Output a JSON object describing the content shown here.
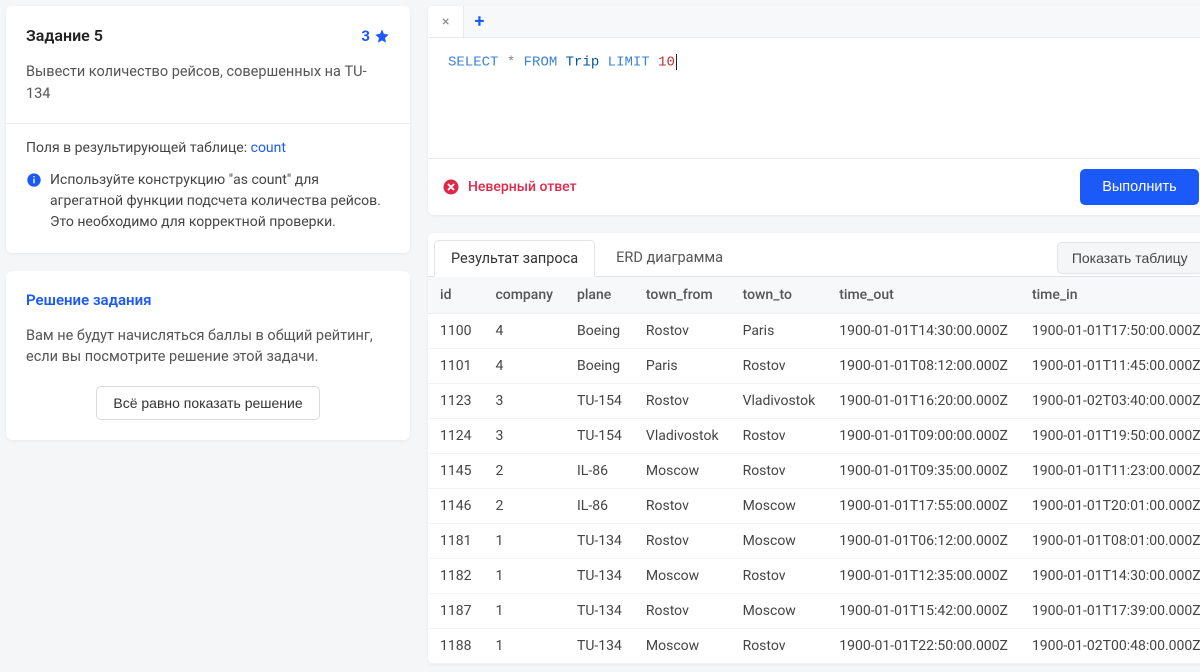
{
  "task": {
    "title": "Задание 5",
    "rating": "3",
    "description": "Вывести количество рейсов, совершенных на TU-134",
    "fields_label": "Поля в результирующей таблице:",
    "fields_value": "count",
    "hint": "Используйте конструкцию \"as count\" для агрегатной функции подсчета количества рейсов. Это необходимо для корректной проверки."
  },
  "solution": {
    "title": "Решение задания",
    "warning": "Вам не будут начисляться баллы в общий рейтинг, если вы посмотрите решение этой задачи.",
    "show_button": "Всё равно показать решение"
  },
  "editor": {
    "tab_label": "",
    "query_tokens": {
      "select": "SELECT",
      "star": "*",
      "from": "FROM",
      "table": "Trip",
      "limit": "LIMIT",
      "num": "10"
    }
  },
  "exec": {
    "error": "Неверный ответ",
    "button": "Выполнить"
  },
  "result": {
    "tab_result": "Результат запроса",
    "tab_erd": "ERD диаграмма",
    "show_table": "Показать таблицу",
    "columns": [
      "id",
      "company",
      "plane",
      "town_from",
      "town_to",
      "time_out",
      "time_in"
    ],
    "rows": [
      [
        "1100",
        "4",
        "Boeing",
        "Rostov",
        "Paris",
        "1900-01-01T14:30:00.000Z",
        "1900-01-01T17:50:00.000Z"
      ],
      [
        "1101",
        "4",
        "Boeing",
        "Paris",
        "Rostov",
        "1900-01-01T08:12:00.000Z",
        "1900-01-01T11:45:00.000Z"
      ],
      [
        "1123",
        "3",
        "TU-154",
        "Rostov",
        "Vladivostok",
        "1900-01-01T16:20:00.000Z",
        "1900-01-02T03:40:00.000Z"
      ],
      [
        "1124",
        "3",
        "TU-154",
        "Vladivostok",
        "Rostov",
        "1900-01-01T09:00:00.000Z",
        "1900-01-01T19:50:00.000Z"
      ],
      [
        "1145",
        "2",
        "IL-86",
        "Moscow",
        "Rostov",
        "1900-01-01T09:35:00.000Z",
        "1900-01-01T11:23:00.000Z"
      ],
      [
        "1146",
        "2",
        "IL-86",
        "Rostov",
        "Moscow",
        "1900-01-01T17:55:00.000Z",
        "1900-01-01T20:01:00.000Z"
      ],
      [
        "1181",
        "1",
        "TU-134",
        "Rostov",
        "Moscow",
        "1900-01-01T06:12:00.000Z",
        "1900-01-01T08:01:00.000Z"
      ],
      [
        "1182",
        "1",
        "TU-134",
        "Moscow",
        "Rostov",
        "1900-01-01T12:35:00.000Z",
        "1900-01-01T14:30:00.000Z"
      ],
      [
        "1187",
        "1",
        "TU-134",
        "Rostov",
        "Moscow",
        "1900-01-01T15:42:00.000Z",
        "1900-01-01T17:39:00.000Z"
      ],
      [
        "1188",
        "1",
        "TU-134",
        "Moscow",
        "Rostov",
        "1900-01-01T22:50:00.000Z",
        "1900-01-02T00:48:00.000Z"
      ]
    ]
  }
}
